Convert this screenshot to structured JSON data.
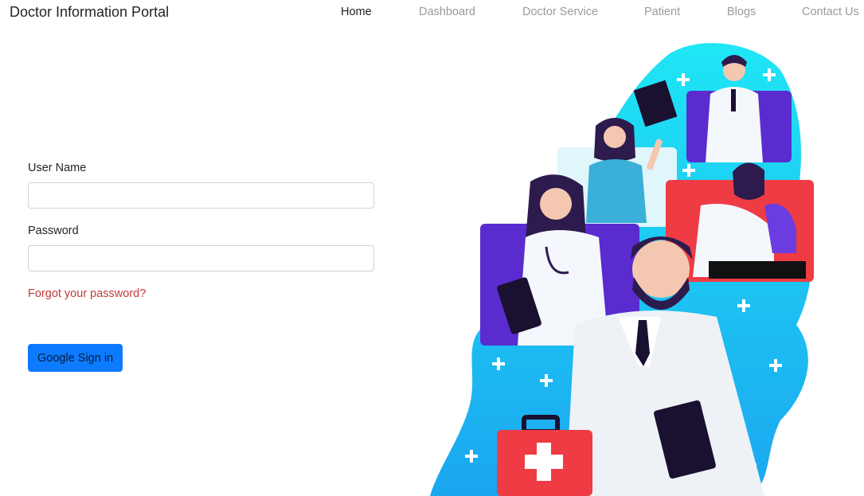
{
  "navbar": {
    "brand": "Doctor Information Portal",
    "links": [
      {
        "label": "Home",
        "active": true
      },
      {
        "label": "Dashboard",
        "active": false
      },
      {
        "label": "Doctor Service",
        "active": false
      },
      {
        "label": "Patient",
        "active": false
      },
      {
        "label": "Blogs",
        "active": false
      },
      {
        "label": "Contact Us",
        "active": false
      }
    ]
  },
  "login_form": {
    "username_label": "User Name",
    "username_value": "",
    "password_label": "Password",
    "password_value": "",
    "forgot_link": "Forgot your password?",
    "submit_label": "Google Sign in"
  },
  "illustration": {
    "name": "doctors-group-illustration"
  },
  "colors": {
    "primary_button": "#0d7bff",
    "forgot_link": "#c0393b",
    "illustration_cyan": "#1fd3f0",
    "illustration_purple": "#5a2ccf",
    "illustration_red": "#ef3b44"
  }
}
